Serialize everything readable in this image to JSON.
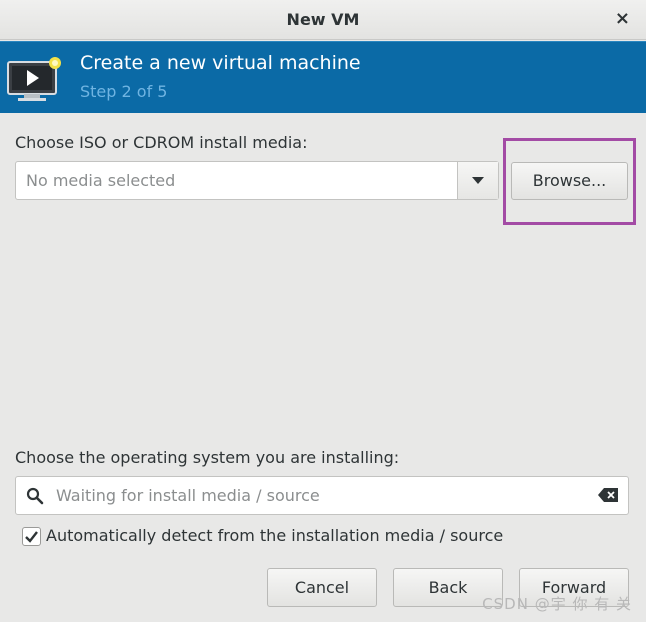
{
  "window": {
    "title": "New VM",
    "close_glyph": "×"
  },
  "banner": {
    "heading": "Create a new virtual machine",
    "step": "Step 2 of 5",
    "icon": "vm-monitor-icon"
  },
  "media": {
    "label": "Choose ISO or CDROM install media:",
    "placeholder": "No media selected",
    "browse_label": "Browse..."
  },
  "os": {
    "label": "Choose the operating system you are installing:",
    "search_placeholder": "Waiting for install media / source",
    "autodetect_label": "Automatically detect from the installation media / source",
    "autodetect_checked": true
  },
  "buttons": {
    "cancel": "Cancel",
    "back": "Back",
    "forward": "Forward"
  },
  "watermark": "CSDN @宇 你 有 关",
  "colors": {
    "banner": "#0b6aa6",
    "highlight": "#a34ba5",
    "step_text": "#6fb4e2"
  }
}
